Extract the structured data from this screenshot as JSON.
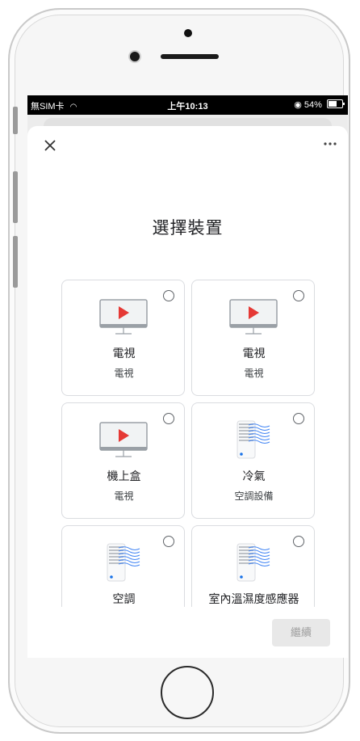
{
  "status_bar": {
    "carrier": "無SIM卡",
    "time": "上午10:13",
    "battery_percent": "54%",
    "battery_level": 0.54
  },
  "sheet": {
    "close_icon": "close-icon",
    "more_icon": "more-horizontal-icon"
  },
  "title": "選擇裝置",
  "devices": [
    {
      "name": "電視",
      "type": "電視",
      "icon": "tv-icon"
    },
    {
      "name": "電視",
      "type": "電視",
      "icon": "tv-icon"
    },
    {
      "name": "機上盒",
      "type": "電視",
      "icon": "tv-icon"
    },
    {
      "name": "冷氣",
      "type": "空調設備",
      "icon": "air-conditioner-icon"
    },
    {
      "name": "空調",
      "type": "",
      "icon": "air-conditioner-icon"
    },
    {
      "name": "室內溫濕度感應器",
      "type": "",
      "icon": "air-conditioner-icon"
    }
  ],
  "footer": {
    "next_label": "繼續"
  },
  "colors": {
    "play_red": "#e53935",
    "tv_screen": "#f1f3f4",
    "tv_border": "#9aa0a6",
    "ac_lines": "#4285f4",
    "ac_dot": "#1a73e8"
  }
}
